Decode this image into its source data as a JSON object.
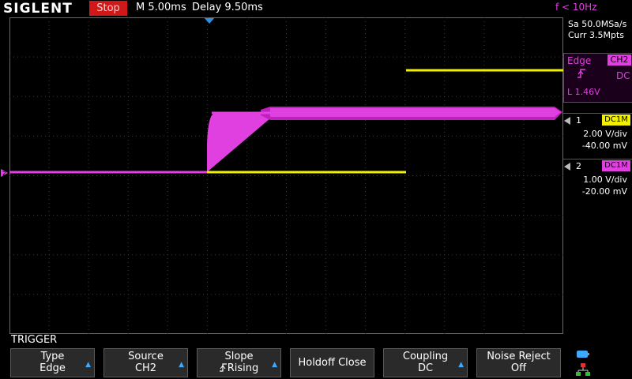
{
  "top_bar": {
    "logo": "SIGLENT",
    "run_status": "Stop",
    "timebase": "M 5.00ms",
    "delay": "Delay 9.50ms",
    "trigger_frequency": "f < 10Hz"
  },
  "acquisition": {
    "sample_rate": "Sa 50.0MSa/s",
    "memory_depth": "Curr 3.5Mpts"
  },
  "trigger_info": {
    "type": "Edge",
    "source": "CH2",
    "slope_icon": "rising-edge-icon",
    "coupling": "DC",
    "level": "L  1.46V"
  },
  "channels": [
    {
      "number": "1",
      "coupling": "DC1M",
      "scale": "2.00 V/div",
      "offset": "-40.00 mV",
      "color": "#f0f000"
    },
    {
      "number": "2",
      "coupling": "DC1M",
      "scale": "1.00 V/div",
      "offset": "-20.00 mV",
      "color": "#e040e0"
    }
  ],
  "menu": {
    "title": "TRIGGER",
    "softkeys": [
      {
        "line1": "Type",
        "line2": "Edge",
        "arrow": true
      },
      {
        "line1": "Source",
        "line2": "CH2",
        "arrow": true
      },
      {
        "line1": "Slope",
        "line2": "Rising",
        "arrow": true,
        "icon": "rising-edge-icon"
      },
      {
        "line1": "Holdoff Close",
        "line2": "",
        "arrow": false
      },
      {
        "line1": "Coupling",
        "line2": "DC",
        "arrow": true
      },
      {
        "line1": "Noise Reject",
        "line2": "Off",
        "arrow": false
      }
    ]
  },
  "colors": {
    "ch1": "#f0f000",
    "ch2": "#e040e0",
    "stop_badge": "#d01818",
    "accent": "#3fa9ff"
  },
  "icons": {
    "trigger_position_marker": "down-triangle-icon",
    "channel_ground_marker": "arrow-right-icon",
    "status_icons": [
      "battery-icon",
      "network-icon"
    ]
  }
}
